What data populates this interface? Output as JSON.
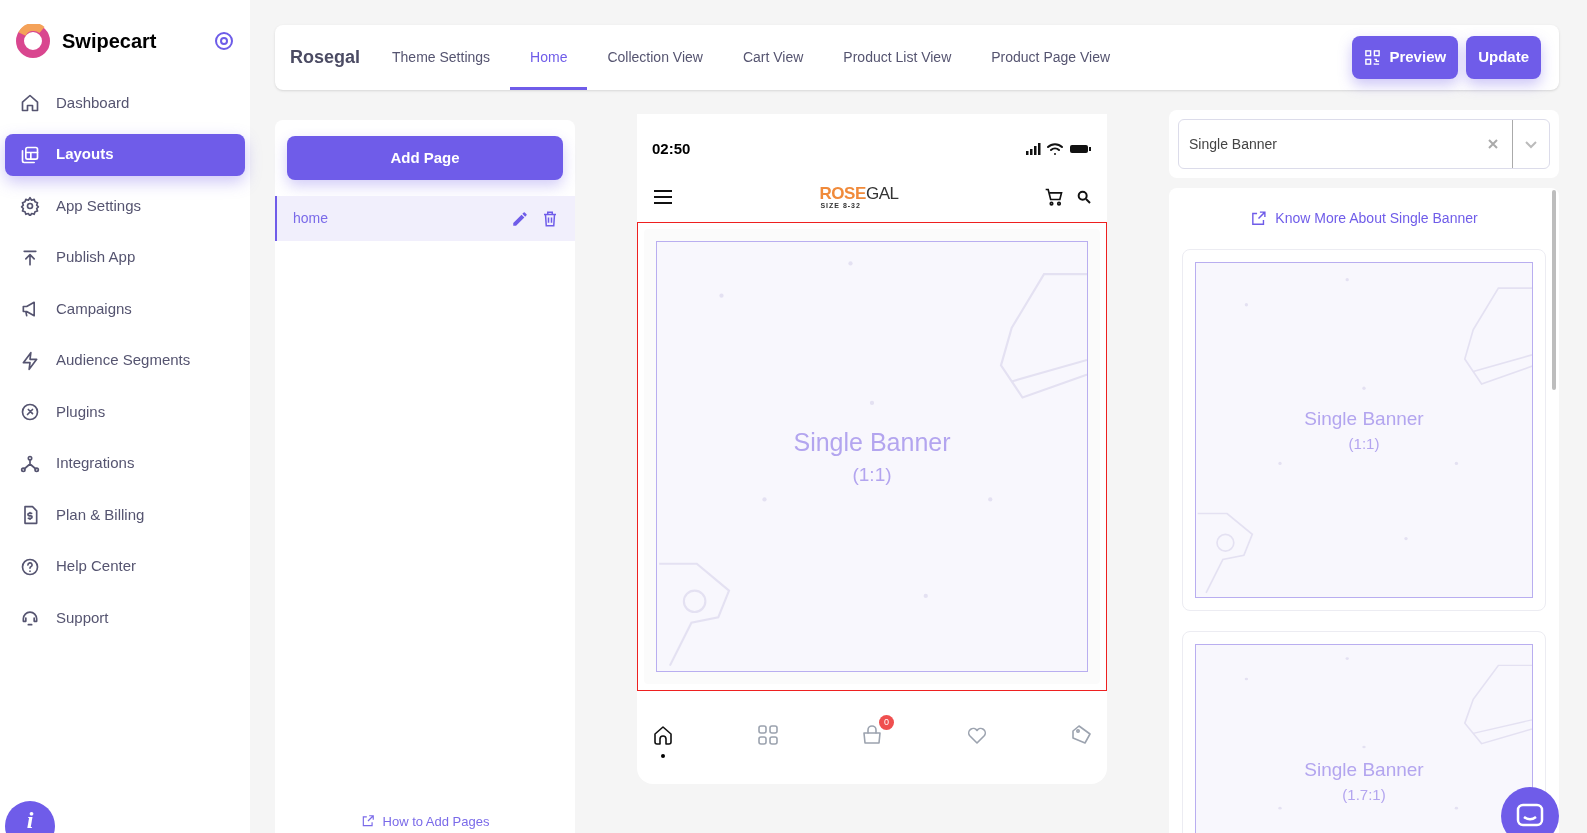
{
  "sidebar": {
    "brand": "Swipecart",
    "items": [
      {
        "kind": "home",
        "label": "Dashboard",
        "selected": false
      },
      {
        "kind": "layouts",
        "label": "Layouts",
        "selected": true
      },
      {
        "kind": "settings",
        "label": "App Settings",
        "selected": false
      },
      {
        "kind": "publish",
        "label": "Publish App",
        "selected": false
      },
      {
        "kind": "megaphone",
        "label": "Campaigns",
        "selected": false
      },
      {
        "kind": "bolt",
        "label": "Audience Segments",
        "selected": false
      },
      {
        "kind": "plug",
        "label": "Plugins",
        "selected": false
      },
      {
        "kind": "network",
        "label": "Integrations",
        "selected": false
      },
      {
        "kind": "billing",
        "label": "Plan & Billing",
        "selected": false
      },
      {
        "kind": "help",
        "label": "Help Center",
        "selected": false
      },
      {
        "kind": "support",
        "label": "Support",
        "selected": false
      }
    ],
    "info_button": "i"
  },
  "topbar": {
    "store": "Rosegal",
    "tabs": [
      {
        "label": "Theme Settings",
        "selected": false
      },
      {
        "label": "Home",
        "selected": true
      },
      {
        "label": "Collection View",
        "selected": false
      },
      {
        "label": "Cart View",
        "selected": false
      },
      {
        "label": "Product List View",
        "selected": false
      },
      {
        "label": "Product Page View",
        "selected": false
      }
    ],
    "buttons": [
      {
        "kind": "preview",
        "label": "Preview"
      },
      {
        "kind": "plain",
        "label": "Update"
      }
    ]
  },
  "pages_panel": {
    "add_button": "Add Page",
    "pages": [
      {
        "name": "home",
        "selected": true
      }
    ],
    "help_link": "How to Add Pages"
  },
  "phone": {
    "time": "02:50",
    "logo": {
      "name_start": "R",
      "name_mark": "O",
      "name_middle": "SE",
      "name_end": "GAL",
      "tagline": "SIZE 8-32"
    },
    "banner": {
      "title": "Single Banner",
      "ratio": "(1:1)",
      "selected": true
    },
    "nav": [
      {
        "kind": "home",
        "selected": true
      },
      {
        "kind": "grid",
        "selected": false
      },
      {
        "kind": "bag",
        "selected": false,
        "badge": "0"
      },
      {
        "kind": "heart",
        "selected": false
      },
      {
        "kind": "tag",
        "selected": false
      }
    ]
  },
  "widget_panel": {
    "select_value": "Single Banner",
    "link": "Know More About Single Banner",
    "templates": [
      {
        "title": "Single Banner",
        "ratio": "(1:1)",
        "kind": "square"
      },
      {
        "title": "Single Banner",
        "ratio": "(1.7:1)",
        "kind": "wide"
      }
    ]
  }
}
